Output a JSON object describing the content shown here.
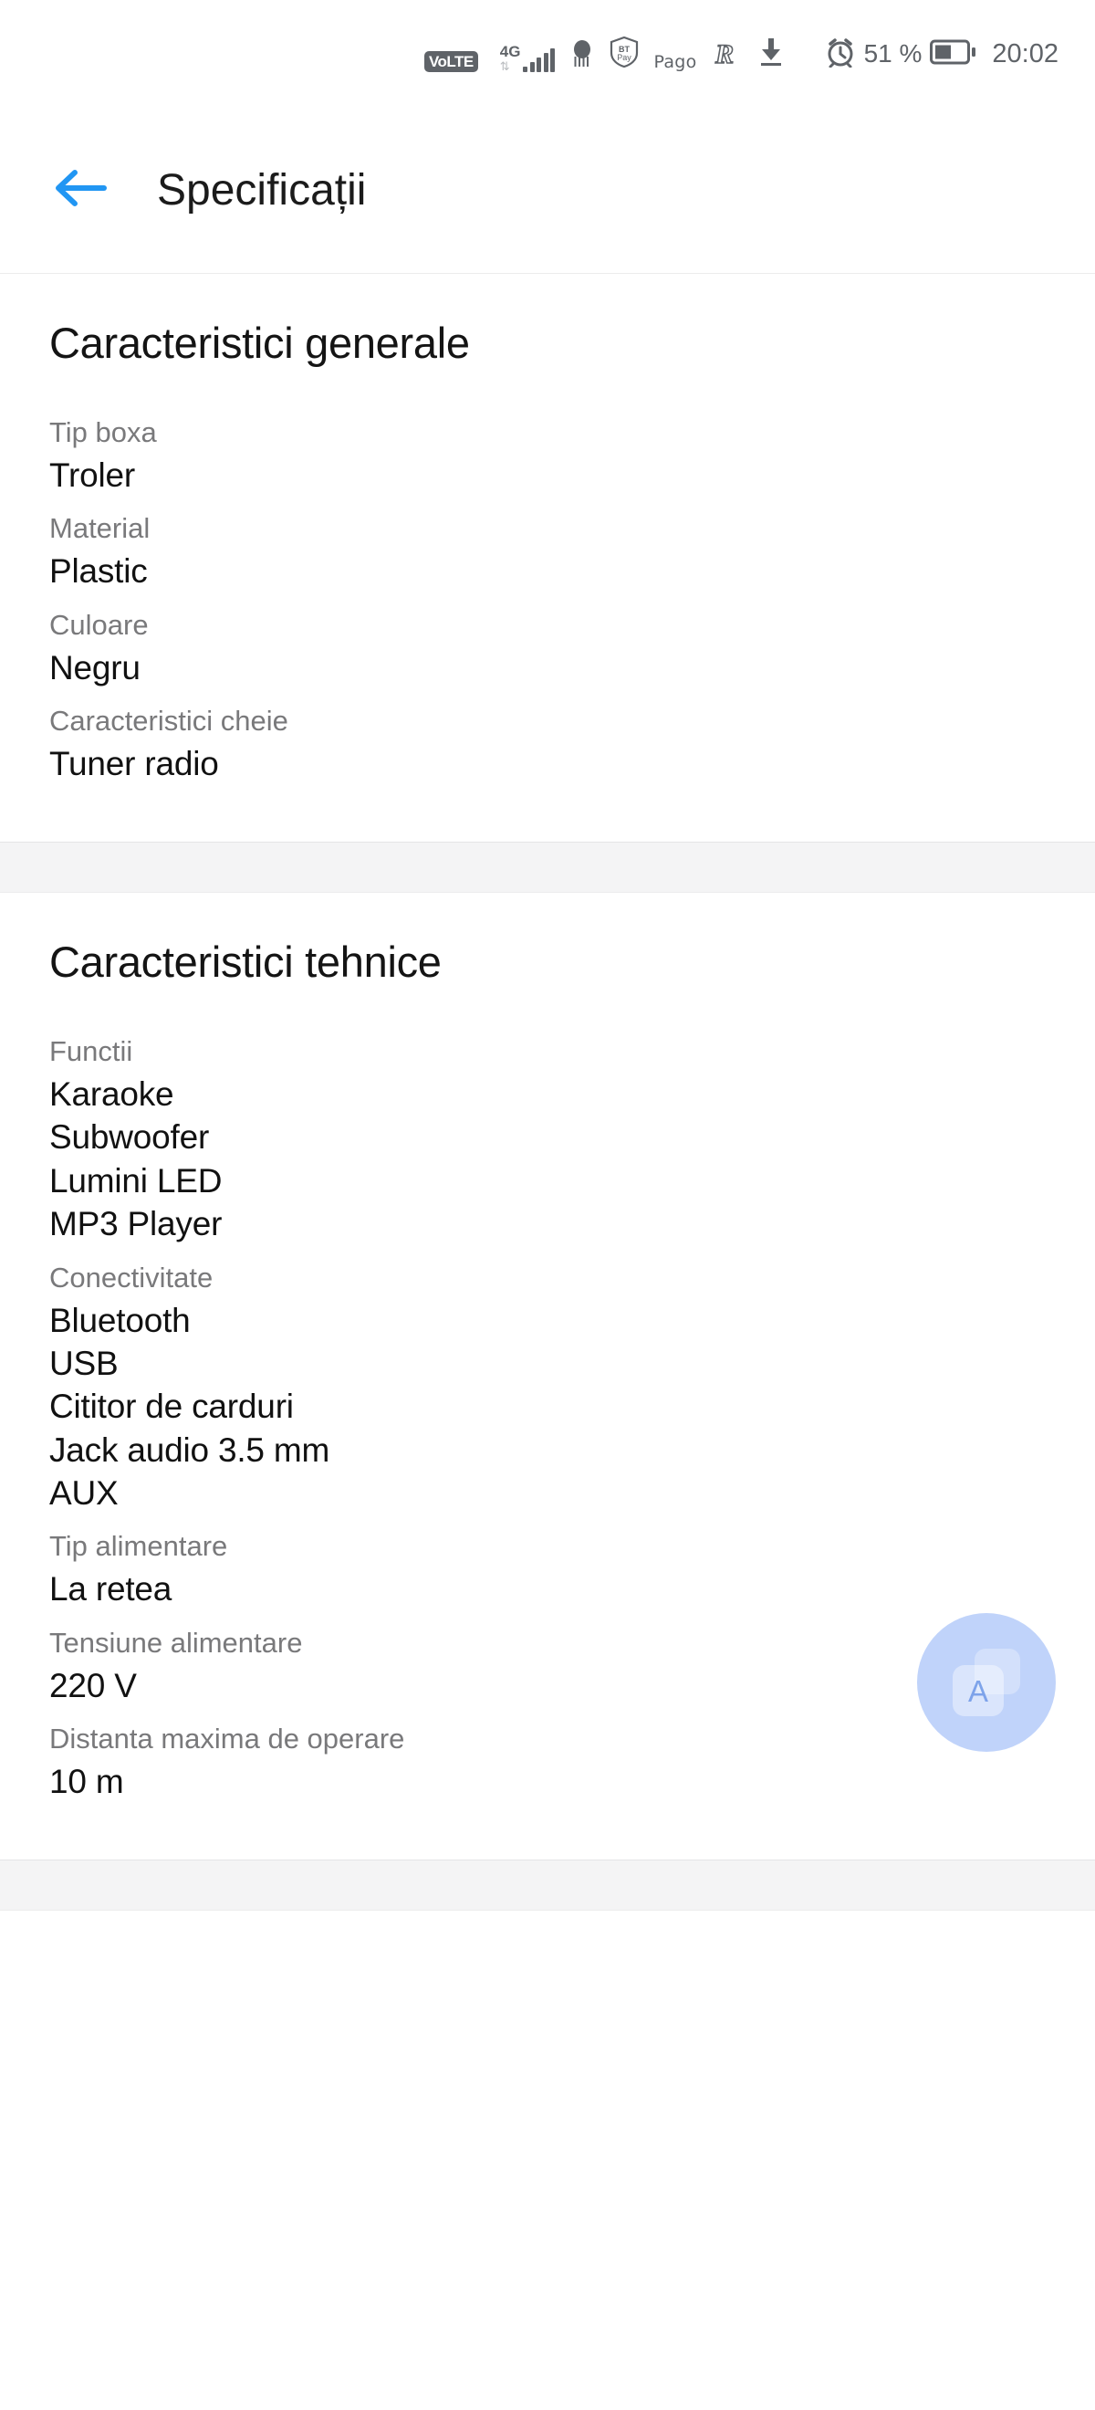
{
  "status_bar": {
    "volte_label": "VoLTE",
    "network_type": "4G",
    "network_arrows": "⇅",
    "signal_bars": 5,
    "icons": [
      "volte-icon",
      "signal-bars-icon",
      "microphone-icon",
      "btpay-icon",
      "pago-icon",
      "revolut-icon",
      "download-icon",
      "alarm-icon",
      "battery-icon"
    ],
    "btpay_label": "BTPay",
    "pago_label": "Pago",
    "revolut_label": "R",
    "battery_percent": "51 %",
    "time": "20:02"
  },
  "app_bar": {
    "back_icon": "arrow-left-icon",
    "back_icon_color": "#2196f3",
    "title": "Specificații"
  },
  "sections": [
    {
      "title": "Caracteristici generale",
      "groups": [
        {
          "label": "Tip boxa",
          "values": [
            "Troler"
          ]
        },
        {
          "label": "Material",
          "values": [
            "Plastic"
          ]
        },
        {
          "label": "Culoare",
          "values": [
            "Negru"
          ]
        },
        {
          "label": "Caracteristici cheie",
          "values": [
            "Tuner radio"
          ]
        }
      ]
    },
    {
      "title": "Caracteristici tehnice",
      "groups": [
        {
          "label": "Functii",
          "values": [
            "Karaoke",
            "Subwoofer",
            "Lumini LED",
            "MP3 Player"
          ]
        },
        {
          "label": "Conectivitate",
          "values": [
            "Bluetooth",
            "USB",
            "Cititor de carduri",
            "Jack audio 3.5 mm",
            "AUX"
          ]
        },
        {
          "label": "Tip alimentare",
          "values": [
            "La retea"
          ]
        },
        {
          "label": "Tensiune alimentare",
          "values": [
            "220 V"
          ]
        },
        {
          "label": "Distanta maxima de operare",
          "values": [
            "10 m"
          ]
        }
      ]
    }
  ],
  "floating_button": {
    "name": "assistant-overlay-button",
    "glyph": "A",
    "color": "#8cafF5"
  },
  "colors": {
    "label_grey": "#79797b",
    "value_black": "#111111",
    "accent_blue": "#2196f3",
    "band_grey": "#f4f4f5"
  }
}
